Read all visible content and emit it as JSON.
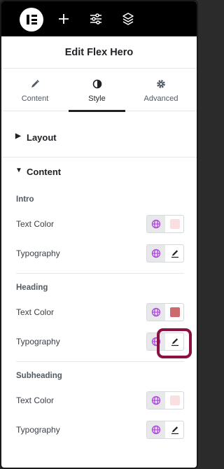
{
  "header": {
    "title": "Edit Flex Hero"
  },
  "tabs": [
    {
      "label": "Content",
      "icon": "pencil-icon",
      "active": false
    },
    {
      "label": "Style",
      "icon": "contrast-icon",
      "active": true
    },
    {
      "label": "Advanced",
      "icon": "gear-icon",
      "active": false
    }
  ],
  "sections": {
    "layout": {
      "label": "Layout",
      "expanded": false
    },
    "content": {
      "label": "Content",
      "expanded": true
    }
  },
  "groups": {
    "intro": {
      "title": "Intro",
      "text_color_label": "Text Color",
      "text_color_value": "#fadfe0",
      "typography_label": "Typography"
    },
    "heading": {
      "title": "Heading",
      "text_color_label": "Text Color",
      "text_color_value": "#cc6b6e",
      "typography_label": "Typography"
    },
    "subheading": {
      "title": "Subheading",
      "text_color_label": "Text Color",
      "text_color_value": "#fadfe0",
      "typography_label": "Typography"
    }
  },
  "colors": {
    "topbar": "#000000",
    "global_icon": "#b044e0",
    "highlight": "#8a1141"
  }
}
